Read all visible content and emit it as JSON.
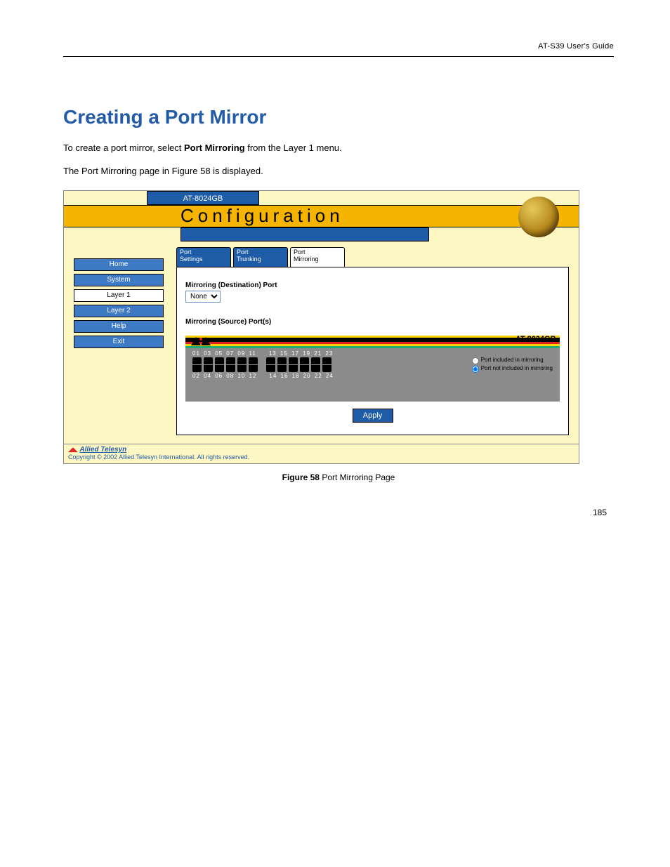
{
  "running_head": "AT-S39 User's Guide",
  "section_title": "Creating a Port Mirror",
  "intro_line1_prefix": "To create a port mirror, select ",
  "intro_line1_bold": "Port Mirroring",
  "intro_line1_suffix": " from the Layer 1 menu.",
  "intro_line2": "The Port Mirroring page in Figure 58 is displayed.",
  "screenshot": {
    "model": "AT-8024GB",
    "title": "Configuration",
    "nav": [
      {
        "label": "Home",
        "active": false
      },
      {
        "label": "System",
        "active": false
      },
      {
        "label": "Layer 1",
        "active": true
      },
      {
        "label": "Layer 2",
        "active": false
      },
      {
        "label": "Help",
        "active": false
      },
      {
        "label": "Exit",
        "active": false
      }
    ],
    "tabs": [
      {
        "label": "Port Settings",
        "active": false
      },
      {
        "label": "Port Trunking",
        "active": false
      },
      {
        "label": "Port Mirroring",
        "active": true
      }
    ],
    "dest_label": "Mirroring (Destination) Port",
    "dest_value": "None",
    "src_label": "Mirroring (Source) Port(s)",
    "port_model": "AT-8024GB",
    "ports_top": [
      "01",
      "03",
      "05",
      "07",
      "09",
      "11",
      "13",
      "15",
      "17",
      "19",
      "21",
      "23"
    ],
    "ports_bottom": [
      "02",
      "04",
      "06",
      "08",
      "10",
      "12",
      "14",
      "16",
      "18",
      "20",
      "22",
      "24"
    ],
    "legend_included": "Port included in mirroring",
    "legend_excluded": "Port not included in mirroring",
    "apply": "Apply",
    "footer_logo": "Allied Telesyn",
    "footer_copy": "Copyright © 2002 Allied Telesyn International. All rights reserved."
  },
  "caption_prefix": "Figure 58",
  "caption_suffix": "  Port Mirroring Page",
  "page_number": "185"
}
